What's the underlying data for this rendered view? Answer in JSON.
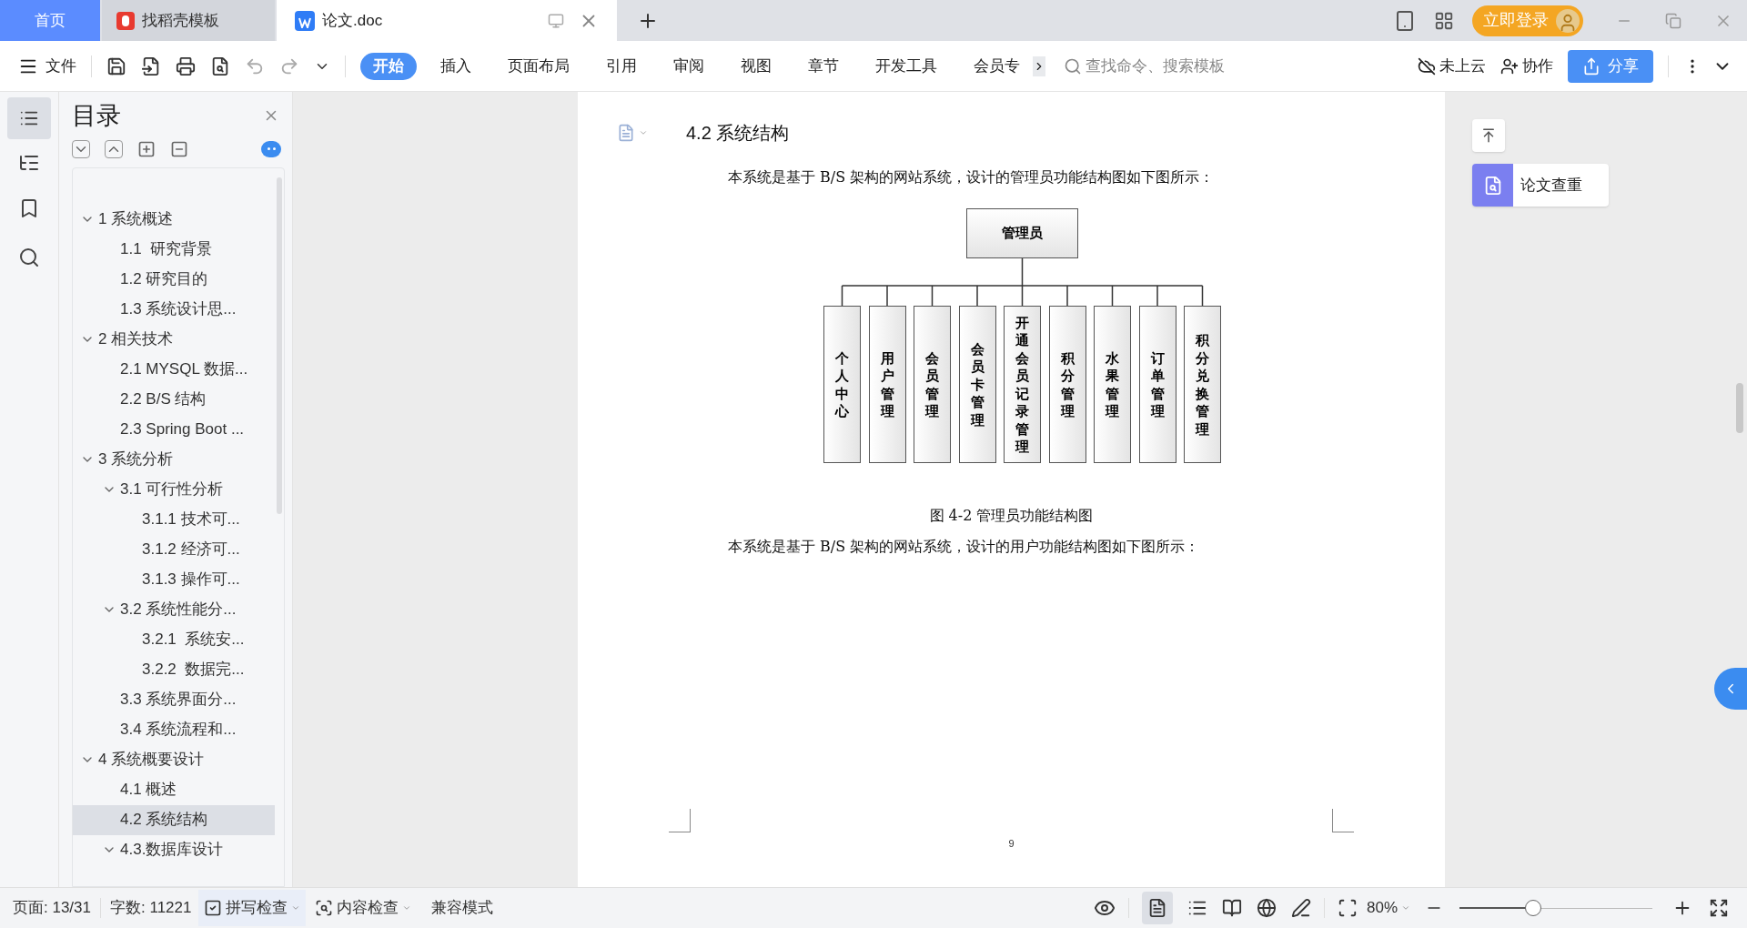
{
  "tabs": [
    {
      "label": "首页",
      "kind": "home",
      "selected": false
    },
    {
      "label": "找稻壳模板",
      "kind": "docer",
      "selected": false
    },
    {
      "label": "论文.doc",
      "kind": "doc",
      "selected": true
    }
  ],
  "title_bar": {
    "login_button": "立即登录"
  },
  "toolbar": {
    "file_menu": "文件",
    "ribbon_tabs": [
      {
        "label": "开始",
        "selected": true
      },
      {
        "label": "插入",
        "selected": false
      },
      {
        "label": "页面布局",
        "selected": false
      },
      {
        "label": "引用",
        "selected": false
      },
      {
        "label": "审阅",
        "selected": false
      },
      {
        "label": "视图",
        "selected": false
      },
      {
        "label": "章节",
        "selected": false
      },
      {
        "label": "开发工具",
        "selected": false
      },
      {
        "label": "会员专",
        "selected": false
      }
    ],
    "search": {
      "placeholder": "查找命令、搜索模板"
    },
    "cloud": "未上云",
    "collaborate": "协作",
    "share": "分享"
  },
  "toc": {
    "title": "目录",
    "items": [
      {
        "label": "1 系统概述",
        "expanded": true,
        "selected": false,
        "children": [
          {
            "label": "1.1  研究背景",
            "selected": false
          },
          {
            "label": "1.2 研究目的",
            "selected": false
          },
          {
            "label": "1.3 系统设计思...",
            "selected": false
          }
        ]
      },
      {
        "label": "2 相关技术",
        "expanded": true,
        "selected": false,
        "children": [
          {
            "label": "2.1 MYSQL 数据...",
            "selected": false
          },
          {
            "label": "2.2 B/S 结构",
            "selected": false
          },
          {
            "label": "2.3 Spring Boot ...",
            "selected": false
          }
        ]
      },
      {
        "label": "3 系统分析",
        "expanded": true,
        "selected": false,
        "children": [
          {
            "label": "3.1 可行性分析",
            "expanded": true,
            "selected": false,
            "children": [
              {
                "label": "3.1.1 技术可...",
                "selected": false
              },
              {
                "label": "3.1.2 经济可...",
                "selected": false
              },
              {
                "label": "3.1.3 操作可...",
                "selected": false
              }
            ]
          },
          {
            "label": "3.2 系统性能分...",
            "expanded": true,
            "selected": false,
            "children": [
              {
                "label": "3.2.1  系统安...",
                "selected": false
              },
              {
                "label": "3.2.2  数据完...",
                "selected": false
              }
            ]
          },
          {
            "label": "3.3 系统界面分...",
            "selected": false
          },
          {
            "label": "3.4 系统流程和...",
            "selected": false
          }
        ]
      },
      {
        "label": "4 系统概要设计",
        "expanded": true,
        "selected": false,
        "children": [
          {
            "label": "4.1 概述",
            "selected": false
          },
          {
            "label": "4.2 系统结构",
            "selected": true
          },
          {
            "label": "4.3.数据库设计",
            "expanded": true,
            "selected": false
          }
        ]
      }
    ]
  },
  "document": {
    "heading": "4.2 系统结构",
    "paragraph_1": "本系统是基于 B/S 架构的网站系统，设计的管理员功能结构图如下图所示：",
    "figure": {
      "root": "管理员",
      "nodes": [
        "个人中心",
        "用户管理",
        "会员管理",
        "会员卡管理",
        "开通会员记录管理",
        "积分管理",
        "水果管理",
        "订单管理",
        "积分兑换管理"
      ]
    },
    "caption": "图 4-2 管理员功能结构图",
    "paragraph_2": "本系统是基于 B/S 架构的网站系统，设计的用户功能结构图如下图所示：",
    "page_number": "9"
  },
  "right_panel": {
    "check_button": "论文查重"
  },
  "status_bar": {
    "page": "页面: 13/31",
    "words": "字数: 11221",
    "spell_check": "拼写检查",
    "content_check": "内容检查",
    "compat_mode": "兼容模式",
    "zoom": "80%",
    "zoom_slider": {
      "level": 0.38
    }
  }
}
